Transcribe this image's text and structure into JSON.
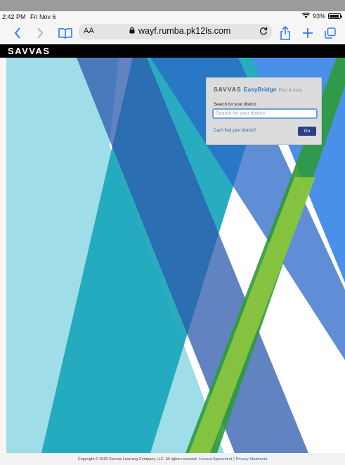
{
  "status_bar": {
    "time": "2:42 PM",
    "date": "Fri Nov 6",
    "battery": "93%"
  },
  "browser": {
    "text_size": "AA",
    "url": "wayf.rumba.pk12ls.com"
  },
  "brand_bar": {
    "logo": "SAVVAS"
  },
  "login_card": {
    "brand_savvas": "SAVVAS",
    "brand_product": "EasyBridge",
    "brand_suffix": "Plus & Auto",
    "search_label": "Search for your district:",
    "search_placeholder": "Search for your district",
    "cant_find_link": "Can't find your district?",
    "go_button": "Go"
  },
  "footer": {
    "copyright": "Copyright © 2020 Savvas Learning Company LLC. All rights reserved.",
    "license_link": "License Agreement",
    "separator": "|",
    "privacy_link": "Privacy Statement"
  },
  "colors": {
    "accent_blue": "#2f7bf6",
    "go_button": "#2c3e87",
    "link": "#2b5ea8"
  }
}
